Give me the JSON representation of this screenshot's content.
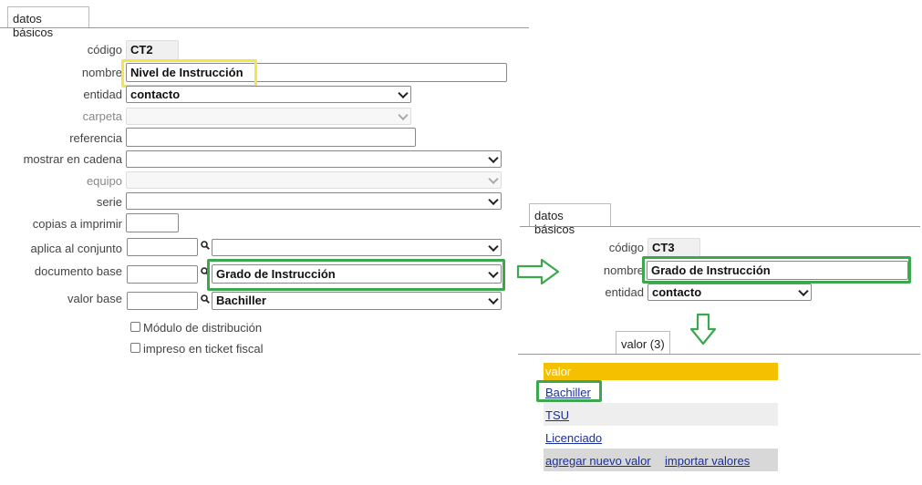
{
  "left_panel": {
    "tab_label": "datos básicos",
    "fields": {
      "codigo": {
        "label": "código",
        "value": "CT2"
      },
      "nombre": {
        "label": "nombre",
        "value": "Nivel de Instrucción"
      },
      "entidad": {
        "label": "entidad",
        "value": "contacto"
      },
      "carpeta": {
        "label": "carpeta",
        "value": ""
      },
      "referencia": {
        "label": "referencia",
        "value": ""
      },
      "mostrar_en_cadena": {
        "label": "mostrar en cadena",
        "value": ""
      },
      "equipo": {
        "label": "equipo",
        "value": ""
      },
      "serie": {
        "label": "serie",
        "value": ""
      },
      "copias_a_imprimir": {
        "label": "copias a imprimir",
        "value": ""
      },
      "aplica_al_conjunto": {
        "label": "aplica al conjunto",
        "code": "",
        "value": ""
      },
      "documento_base": {
        "label": "documento base",
        "code": "",
        "value": "Grado de Instrucción"
      },
      "valor_base": {
        "label": "valor base",
        "code": "",
        "value": "Bachiller"
      }
    },
    "checkboxes": [
      {
        "label": "Módulo de distribución",
        "checked": false
      },
      {
        "label": "impreso en ticket fiscal",
        "checked": false
      }
    ]
  },
  "right_panel": {
    "tab_label": "datos básicos",
    "fields": {
      "codigo": {
        "label": "código",
        "value": "CT3"
      },
      "nombre": {
        "label": "nombre",
        "value": "Grado de Instrucción"
      },
      "entidad": {
        "label": "entidad",
        "value": "contacto"
      }
    },
    "valor_tab_label": "valor (3)",
    "table": {
      "header": "valor",
      "rows": [
        "Bachiller",
        "TSU",
        "Licenciado"
      ],
      "footer_links": [
        "agregar nuevo valor",
        "importar valores"
      ]
    }
  },
  "icons": {
    "search": "magnifier-icon",
    "dropdown": "chevron-down-icon",
    "arrow": "arrow-icon"
  },
  "colors": {
    "highlight_yellow": "#f2e64a",
    "highlight_green": "#3ca84e",
    "table_header": "#f5c000",
    "link": "#1a2e9e"
  }
}
